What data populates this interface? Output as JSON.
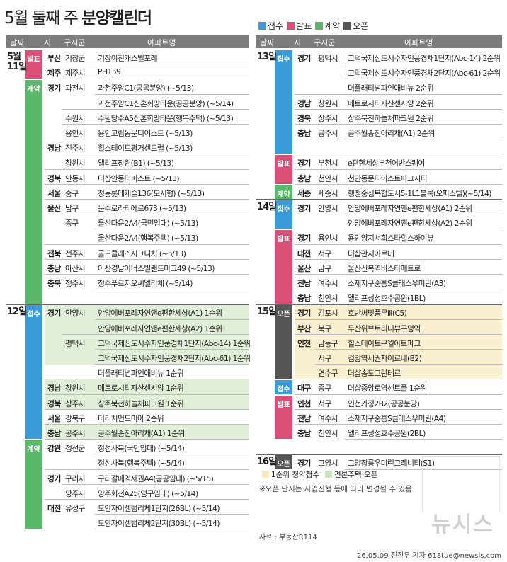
{
  "title_prefix": "5월 둘째 주 ",
  "title_bold": "분양캘린더",
  "legend": [
    {
      "label": "접수",
      "color": "#3a9bd9"
    },
    {
      "label": "발표",
      "color": "#d94f77"
    },
    {
      "label": "계약",
      "color": "#5ab86a"
    },
    {
      "label": "오픈",
      "color": "#555555"
    }
  ],
  "headers": {
    "date": "날짜",
    "city": "시",
    "gu": "구시군",
    "apt": "아파트명"
  },
  "colors": {
    "accept": "#3a9bd9",
    "announce": "#d94f77",
    "contract": "#5ab86a",
    "open": "#555555",
    "rank1_bg": "#fbefd2",
    "model_bg": "#e2efd8"
  },
  "left": {
    "days": [
      {
        "label": "5월\n11일",
        "row": 0
      },
      {
        "label": "12일",
        "row": 17
      }
    ],
    "types": [
      {
        "label": "발표",
        "kind": "announce",
        "start": 0,
        "span": 2
      },
      {
        "label": "계약",
        "kind": "contract",
        "start": 2,
        "span": 15
      },
      {
        "label": "접수",
        "kind": "accept",
        "start": 17,
        "span": 9
      },
      {
        "label": "계약",
        "kind": "contract",
        "start": 26,
        "span": 6
      }
    ],
    "rows": [
      {
        "city": "부산",
        "gu": "기장군",
        "apt": "기장이진캐스빌포레",
        "bg": ""
      },
      {
        "city": "제주",
        "gu": "제주시",
        "apt": "PH159",
        "bg": ""
      },
      {
        "city": "경기",
        "gu": "과천시",
        "apt": "과천주암C1(공공분양) (~5/13)",
        "bg": ""
      },
      {
        "city": "",
        "gu": "",
        "apt": "과천주암C1신혼희망타운(공공분양) (~5/14)",
        "bg": ""
      },
      {
        "city": "",
        "gu": "수원시",
        "apt": "수원당수A5신혼희망타운(행복주택) (~5/13)",
        "bg": ""
      },
      {
        "city": "",
        "gu": "용인시",
        "apt": "용인고림동문디이스트 (~5/13)",
        "bg": ""
      },
      {
        "city": "경남",
        "gu": "진주시",
        "apt": "힐스테이트평거센트럴 (~5/13)",
        "bg": ""
      },
      {
        "city": "",
        "gu": "창원시",
        "apt": "엘리프창원(B1) (~5/13)",
        "bg": ""
      },
      {
        "city": "경북",
        "gu": "안동시",
        "apt": "더샵안동더퍼스트 (~5/13)",
        "bg": ""
      },
      {
        "city": "서울",
        "gu": "중구",
        "apt": "정동롯데캐슬136(도시형) (~5/13)",
        "bg": ""
      },
      {
        "city": "울산",
        "gu": "남구",
        "apt": "문수로라티에르673 (~5/13)",
        "bg": ""
      },
      {
        "city": "",
        "gu": "중구",
        "apt": "울산다운2A4(국민임대) (~5/13)",
        "bg": ""
      },
      {
        "city": "",
        "gu": "",
        "apt": "울산다운2A4(행복주택) (~5/13)",
        "bg": ""
      },
      {
        "city": "전북",
        "gu": "전주시",
        "apt": "골드클래스시그니처 (~5/13)",
        "bg": ""
      },
      {
        "city": "충남",
        "gu": "아산시",
        "apt": "아산경남아너스빌랜드마크49 (~5/13)",
        "bg": ""
      },
      {
        "city": "충북",
        "gu": "청주시",
        "apt": "청주푸르지오씨엘리체 (~5/14)",
        "bg": ""
      },
      {
        "city": "",
        "gu": "",
        "apt": "",
        "bg": "none"
      },
      {
        "city": "경기",
        "gu": "안양시",
        "apt": "안양에버포레자연앤e편한세상(A1) 1순위",
        "bg": "model"
      },
      {
        "city": "",
        "gu": "",
        "apt": "안양에버포레자연앤e편한세상(A2) 1순위",
        "bg": "model"
      },
      {
        "city": "",
        "gu": "평택시",
        "apt": "고덕국제신도시수자인풍경채1단지(Abc-14) 1순위",
        "bg": "model"
      },
      {
        "city": "",
        "gu": "",
        "apt": "고덕국제신도시수자인풍경채2단지(Abc-61) 1순위",
        "bg": "model"
      },
      {
        "city": "",
        "gu": "",
        "apt": "더플래티넘파인애비뉴 1순위",
        "bg": ""
      },
      {
        "city": "경남",
        "gu": "창원시",
        "apt": "메트로시티자산센시앙 1순위",
        "bg": "model"
      },
      {
        "city": "경북",
        "gu": "상주시",
        "apt": "상주북천하늘채파크원 1순위",
        "bg": "model"
      },
      {
        "city": "서울",
        "gu": "강북구",
        "apt": "더리치먼드미아 2순위",
        "bg": ""
      },
      {
        "city": "충남",
        "gu": "공주시",
        "apt": "공주월송진아리채(A1) 1순위",
        "bg": "model"
      },
      {
        "city": "강원",
        "gu": "정선군",
        "apt": "정선사북(국민임대) (~5/14)",
        "bg": ""
      },
      {
        "city": "",
        "gu": "",
        "apt": "정선사북(행복주택) (~5/14)",
        "bg": ""
      },
      {
        "city": "경기",
        "gu": "구리시",
        "apt": "구리갈매역세권A4(공공임대) (~5/15)",
        "bg": ""
      },
      {
        "city": "",
        "gu": "양주시",
        "apt": "양주회천A25(영구임대) (~5/14)",
        "bg": ""
      },
      {
        "city": "대전",
        "gu": "유성구",
        "apt": "도안자이센텀리체1단지(26BL) (~5/14)",
        "bg": ""
      },
      {
        "city": "",
        "gu": "",
        "apt": "도안자이센텀리체2단지(30BL) (~5/14)",
        "bg": ""
      }
    ]
  },
  "right": {
    "days": [
      {
        "label": "13일",
        "row": 0
      },
      {
        "label": "14일",
        "row": 10
      },
      {
        "label": "15일",
        "row": 17
      },
      {
        "label": "16일",
        "row": 27
      }
    ],
    "types": [
      {
        "label": "접수",
        "kind": "accept",
        "start": 0,
        "span": 7
      },
      {
        "label": "발표",
        "kind": "announce",
        "start": 7,
        "span": 2
      },
      {
        "label": "계약",
        "kind": "contract",
        "start": 9,
        "span": 1
      },
      {
        "label": "접수",
        "kind": "accept",
        "start": 10,
        "span": 2
      },
      {
        "label": "발표",
        "kind": "announce",
        "start": 12,
        "span": 5
      },
      {
        "label": "오픈",
        "kind": "open",
        "start": 17,
        "span": 5
      },
      {
        "label": "접수",
        "kind": "accept",
        "start": 22,
        "span": 1
      },
      {
        "label": "발표",
        "kind": "announce",
        "start": 23,
        "span": 3
      },
      {
        "label": "오픈",
        "kind": "open",
        "start": 27,
        "span": 1
      }
    ],
    "rows": [
      {
        "city": "경기",
        "gu": "평택시",
        "apt": "고덕국제신도시수자인풍경채1단지(Abc-14) 2순위",
        "bg": ""
      },
      {
        "city": "",
        "gu": "",
        "apt": "고덕국제신도시수자인풍경채2단지(Abc-61) 2순위",
        "bg": ""
      },
      {
        "city": "",
        "gu": "",
        "apt": "더플래티넘파인애비뉴 2순위",
        "bg": ""
      },
      {
        "city": "경남",
        "gu": "창원시",
        "apt": "메트로시티자산센시앙 2순위",
        "bg": ""
      },
      {
        "city": "경북",
        "gu": "상주시",
        "apt": "상주북천하늘채파크원 2순위",
        "bg": ""
      },
      {
        "city": "충남",
        "gu": "공주시",
        "apt": "공주월송진아리채(A1) 2순위",
        "bg": ""
      },
      {
        "city": "",
        "gu": "",
        "apt": "",
        "bg": "none"
      },
      {
        "city": "경기",
        "gu": "부천시",
        "apt": "e편한세상부천어반스퀘어",
        "bg": ""
      },
      {
        "city": "충남",
        "gu": "천안시",
        "apt": "천안동문디이스트파크시티",
        "bg": ""
      },
      {
        "city": "세종",
        "gu": "세종시",
        "apt": "행정중심복합도시5-1L1블록(오피스텔)(~5/14)",
        "bg": ""
      },
      {
        "city": "경기",
        "gu": "안양시",
        "apt": "안양에버포레자연앤e편한세상(A1) 2순위",
        "bg": ""
      },
      {
        "city": "",
        "gu": "",
        "apt": "안양에버포레자연앤e편한세상(A2) 2순위",
        "bg": ""
      },
      {
        "city": "경기",
        "gu": "용인시",
        "apt": "용인양지서희스타힐스하이뷰",
        "bg": ""
      },
      {
        "city": "대전",
        "gu": "서구",
        "apt": "더샵관저아르테",
        "bg": ""
      },
      {
        "city": "울산",
        "gu": "남구",
        "apt": "울산신복역비스타메트로",
        "bg": ""
      },
      {
        "city": "전남",
        "gu": "여수시",
        "apt": "소제지구중흥S클래스우미린(A3)",
        "bg": ""
      },
      {
        "city": "충남",
        "gu": "천안시",
        "apt": "엘리프성성호수공원(1BL)",
        "bg": ""
      },
      {
        "city": "경기",
        "gu": "김포시",
        "apt": "호반써밋풍무Ⅲ(C5)",
        "bg": "rank1"
      },
      {
        "city": "부산",
        "gu": "북구",
        "apt": "두산위브트리니뷰구명역",
        "bg": "rank1"
      },
      {
        "city": "인천",
        "gu": "남동구",
        "apt": "힐스테이트구월아트파크",
        "bg": "rank1"
      },
      {
        "city": "",
        "gu": "서구",
        "apt": "검암역세권자이르네(B2)",
        "bg": "rank1"
      },
      {
        "city": "",
        "gu": "연수구",
        "apt": "더샵송도그란테르",
        "bg": "rank1"
      },
      {
        "city": "대구",
        "gu": "중구",
        "apt": "더샵중앙로역센트플 1순위",
        "bg": ""
      },
      {
        "city": "인천",
        "gu": "서구",
        "apt": "인천가정2B2(공공분양)",
        "bg": ""
      },
      {
        "city": "전남",
        "gu": "여수시",
        "apt": "소제지구중흥S클래스우미린(A4)",
        "bg": ""
      },
      {
        "city": "충남",
        "gu": "천안시",
        "apt": "엘리프성성호수공원(2BL)",
        "bg": ""
      },
      {
        "city": "",
        "gu": "",
        "apt": "",
        "bg": "none"
      },
      {
        "city": "경기",
        "gu": "고양시",
        "apt": "고양창릉우미린그레니티(S1)",
        "bg": ""
      }
    ]
  },
  "bottom_legend": [
    {
      "label": "1순위 청약접수",
      "color": "#fbe7b8"
    },
    {
      "label": "견본주택 오픈",
      "color": "#c9e2b7"
    }
  ],
  "note": "※오픈 단지는 사업진행 등에 따라 변경될 수 있음",
  "source": "자료 : 부동산R114",
  "credit": "26.05.09 전진우 기자 618tue@newsis.com",
  "watermark": "뉴시스"
}
